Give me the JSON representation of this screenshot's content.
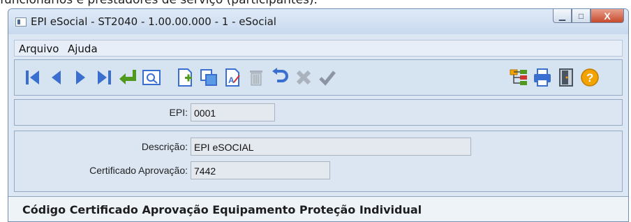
{
  "caption": "funcionários e prestadores de serviço (participantes).",
  "window": {
    "title": "EPI eSocial - ST2040 - 1.00.00.000 - 1 - eSocial",
    "minimize_glyph": "▁",
    "maximize_glyph": "□",
    "close_glyph": "X"
  },
  "menu": {
    "items": [
      "Arquivo",
      "Ajuda"
    ]
  },
  "toolbar": {
    "icons": [
      "first-record-icon",
      "previous-record-icon",
      "next-record-icon",
      "last-record-icon",
      "enter-icon",
      "search-preview-icon",
      "new-record-icon",
      "copy-record-icon",
      "edit-record-icon",
      "delete-record-icon",
      "undo-icon",
      "cancel-icon",
      "confirm-icon",
      "tree-icon",
      "print-icon",
      "exit-icon",
      "help-icon"
    ],
    "accent": "#3a6fd0",
    "green": "#4f9a1c",
    "help_orange": "#f2a300"
  },
  "form": {
    "epi_label": "EPI:",
    "epi_value": "0001",
    "descricao_label": "Descrição:",
    "descricao_value": "EPI eSOCIAL",
    "certificado_label": "Certificado Aprovação:",
    "certificado_value": "7442"
  },
  "status": {
    "text": "Código Certificado Aprovação Equipamento Proteção Individual"
  }
}
